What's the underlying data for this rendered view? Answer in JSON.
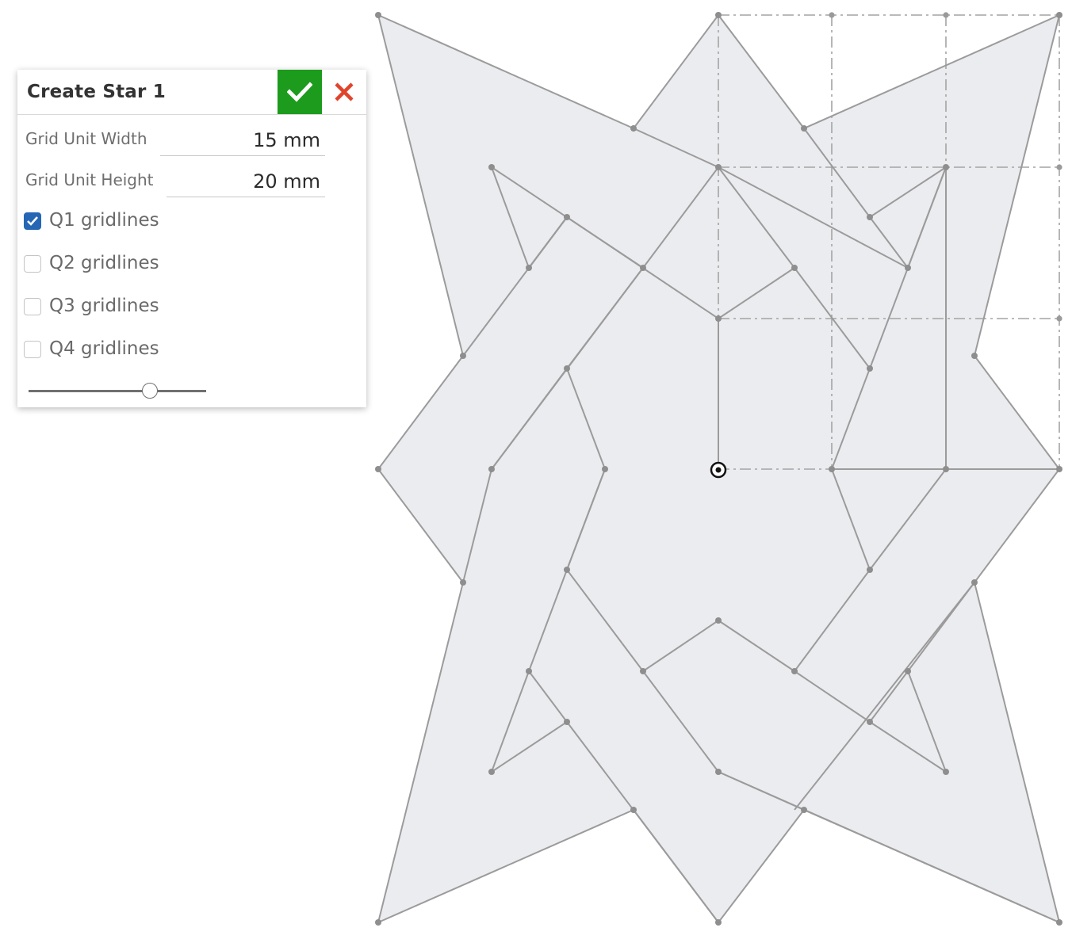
{
  "dialog": {
    "title": "Create Star 1",
    "accept_icon": "checkmark-icon",
    "cancel_icon": "close-icon",
    "accept_color": "#1d9b1d",
    "cancel_color": "#e0452b",
    "fields": [
      {
        "label": "Grid Unit Width",
        "value": "15 mm"
      },
      {
        "label": "Grid Unit Height",
        "value": "20 mm"
      }
    ],
    "checkboxes": [
      {
        "label": "Q1 gridlines",
        "checked": true
      },
      {
        "label": "Q2 gridlines",
        "checked": false
      },
      {
        "label": "Q3 gridlines",
        "checked": false
      },
      {
        "label": "Q4 gridlines",
        "checked": false
      }
    ],
    "slider_fraction": 0.69
  },
  "canvas": {
    "fill_color": "#ebecef",
    "line_color": "#9b9b9b",
    "origin_icon": "origin-marker-icon"
  }
}
